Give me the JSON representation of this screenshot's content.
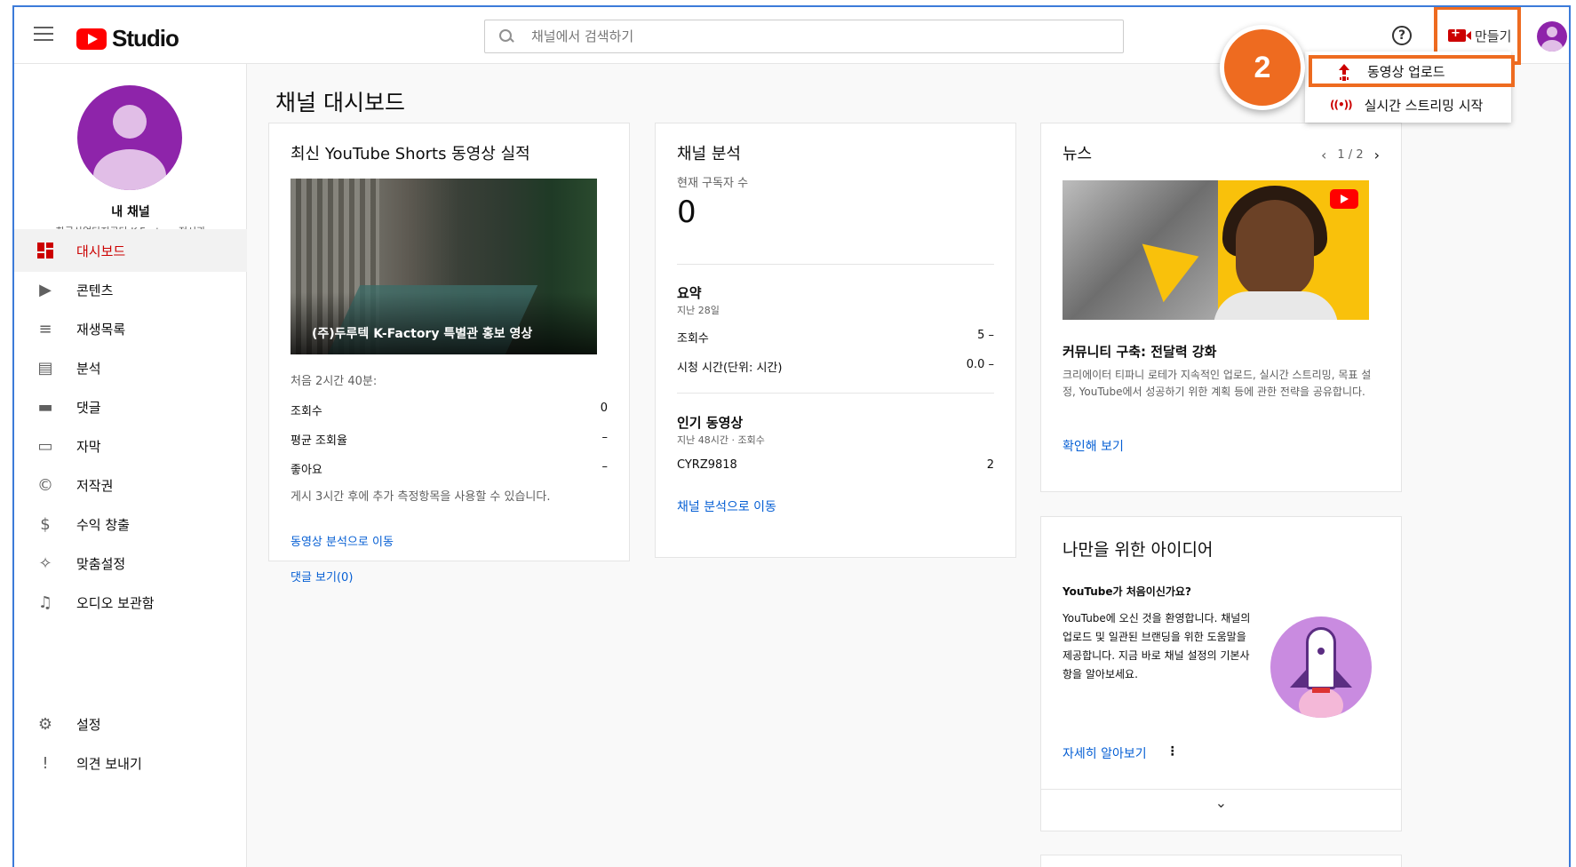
{
  "header": {
    "search_placeholder": "채널에서 검색하기",
    "logo_text": "Studio",
    "create_label": "만들기"
  },
  "dropdown": {
    "upload_label": "동영상 업로드",
    "live_label": "실시간 스트리밍 시작",
    "live_icon": "((•))"
  },
  "badge": "2",
  "sidebar": {
    "channel_title": "내 채널",
    "channel_sub": "한국산업단지공단 K-Factory 전시관",
    "items": [
      {
        "label": "대시보드",
        "icon": "dashboard-icon"
      },
      {
        "label": "콘텐츠",
        "icon": "content-icon"
      },
      {
        "label": "재생목록",
        "icon": "playlist-icon"
      },
      {
        "label": "분석",
        "icon": "analytics-icon"
      },
      {
        "label": "댓글",
        "icon": "comments-icon"
      },
      {
        "label": "자막",
        "icon": "subtitles-icon"
      },
      {
        "label": "저작권",
        "icon": "copyright-icon"
      },
      {
        "label": "수익 창출",
        "icon": "dollar-icon"
      },
      {
        "label": "맞춤설정",
        "icon": "customization-icon"
      },
      {
        "label": "오디오 보관함",
        "icon": "audio-library-icon"
      }
    ],
    "settings_label": "설정",
    "feedback_label": "의견 보내기"
  },
  "main": {
    "page_title": "채널 대시보드",
    "shorts": {
      "title": "최신 YouTube Shorts 동영상 실적",
      "caption": "(주)두루텍 K-Factory 특별관 홍보 영상",
      "period": "처음 2시간 40분:",
      "rows": [
        {
          "label": "조회수",
          "value": "0"
        },
        {
          "label": "평균 조회율",
          "value": "–"
        },
        {
          "label": "좋아요",
          "value": "–"
        }
      ],
      "note": "게시 3시간 후에 추가 측정항목을 사용할 수 있습니다.",
      "link1": "동영상 분석으로 이동",
      "link2": "댓글 보기(0)"
    },
    "analytics": {
      "title": "채널 분석",
      "subs_label": "현재 구독자 수",
      "subs_value": "0",
      "summary_title": "요약",
      "summary_period": "지난 28일",
      "rows": [
        {
          "label": "조회수",
          "value": "5 –"
        },
        {
          "label": "시청 시간(단위: 시간)",
          "value": "0.0 –"
        }
      ],
      "top_title": "인기 동영상",
      "top_period": "지난 48시간 · 조회수",
      "top_rows": [
        {
          "label": "CYRZ9818",
          "value": "2"
        }
      ],
      "link": "채널 분석으로 이동"
    },
    "news": {
      "title": "뉴스",
      "pager": "1 / 2",
      "headline": "커뮤니티 구축: 전달력 강화",
      "body": "크리에이터 티파니 로테가 지속적인 업로드, 실시간 스트리밍, 목표 설정, YouTube에서 성공하기 위한 계획 등에 관한 전략을 공유합니다.",
      "link": "확인해 보기"
    },
    "ideas": {
      "title": "나만을 위한 아이디어",
      "subtitle": "YouTube가 처음이신가요?",
      "body": "YouTube에 오신 것을 환영합니다. 채널의 업로드 및 일관된 브랜딩을 위한 도움말을 제공합니다. 지금 바로 채널 설정의 기본사항을 알아보세요.",
      "link": "자세히 알아보기"
    }
  }
}
